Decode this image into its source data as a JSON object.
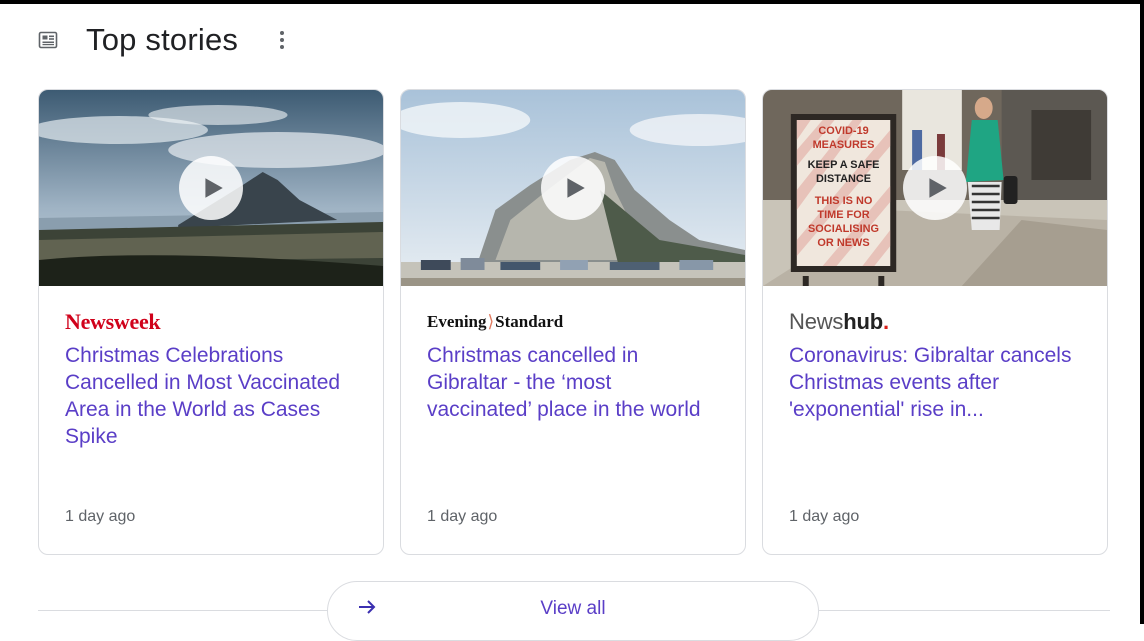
{
  "header": {
    "title": "Top stories",
    "icon": "newspaper-icon",
    "more_icon": "more-vert-icon"
  },
  "stories": [
    {
      "source": "Newsweek",
      "headline": "Christmas Celebrations Cancelled in Most Vaccinated Area in the World as Cases Spike",
      "time": "1 day ago",
      "brand_color": "#d0021b"
    },
    {
      "source_part1": "Evening",
      "source_part2": "Standard",
      "headline": "Christmas cancelled in Gibraltar - the ‘most vaccinated’ place in the world",
      "time": "1 day ago"
    },
    {
      "source_part1": "News",
      "source_part2": "hub",
      "source_part3": ".",
      "headline": "Coronavirus: Gibraltar cancels Christmas events after 'exponential' rise in...",
      "time": "1 day ago",
      "brand_color": "#d91e18"
    },
    {
      "sign_lines": [
        "COVID-19",
        "MEASURES",
        "KEEP A SAFE",
        "DISTANCE",
        "THIS IS NO",
        "TIME FOR",
        "SOCIALISING",
        "OR NEWS"
      ]
    }
  ],
  "view_all": {
    "label": "View all",
    "icon": "arrow-right-icon"
  },
  "colors": {
    "link": "#5a3ec7",
    "border": "#dadce0",
    "meta": "#5f6368"
  }
}
